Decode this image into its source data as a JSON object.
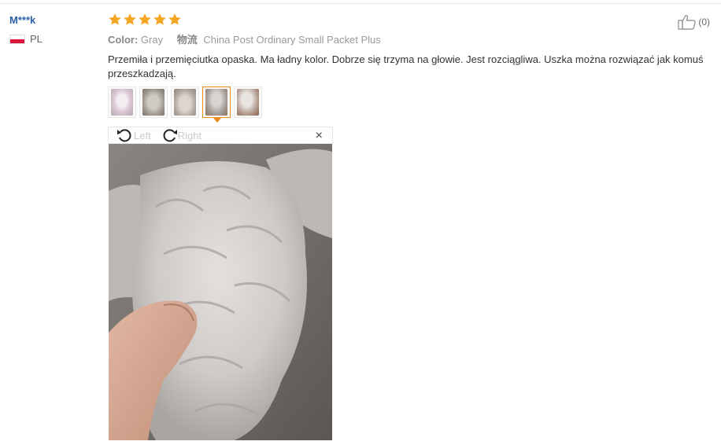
{
  "reviewer": {
    "name": "M***k",
    "country_code": "PL"
  },
  "rating": {
    "stars": 5,
    "color": "#f5a623"
  },
  "attributes": {
    "color_label": "Color:",
    "color_value": "Gray",
    "shipping_label": "物流",
    "shipping_value": "China Post Ordinary Small Packet Plus"
  },
  "review_text": "Przemiła i przemięciutka opaska. Ma ładny kolor. Dobrze się trzyma na głowie. Jest rozciągliwa. Uszka można rozwiązać jak komuś przeszkadzają.",
  "helpful": {
    "count": "(0)",
    "icon": "thumbs-up-icon"
  },
  "thumbnails": {
    "count": 5,
    "active_index": 3
  },
  "viewer": {
    "rotate_left_label": "Left",
    "rotate_right_label": "Right",
    "close_label": "×"
  },
  "colors": {
    "accent": "#e88b1a",
    "name_link": "#2a5fa8"
  }
}
